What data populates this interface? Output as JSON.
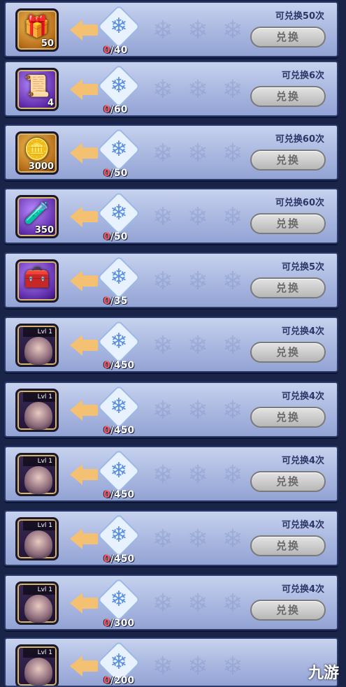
{
  "button_label": "兑换",
  "currency_icon": "snowflake-star-emblem",
  "colors": {
    "row_bg": "#a9b7e0",
    "arrow": "#f4c071",
    "current_count": "#ff5b5b",
    "button_disabled": "#b7b7b7"
  },
  "rows": [
    {
      "icon": "golden-chest-item-icon",
      "style": "gold",
      "glyph": "🎁",
      "qty": "50",
      "current": "0",
      "cost": "/40",
      "limit": "可兑换50次"
    },
    {
      "icon": "purple-scroll-icon",
      "style": "purple",
      "glyph": "📜",
      "qty": "4",
      "current": "0",
      "cost": "/60",
      "limit": "可兑换6次"
    },
    {
      "icon": "gold-coin-pile-icon",
      "style": "gold",
      "glyph": "🪙",
      "qty": "3000",
      "current": "0",
      "cost": "/50",
      "limit": "可兑换60次"
    },
    {
      "icon": "potion-bottle-icon",
      "style": "purple",
      "glyph": "🧪",
      "qty": "350",
      "current": "0",
      "cost": "/50",
      "limit": "可兑换60次"
    },
    {
      "icon": "treasure-chest-icon",
      "style": "purple",
      "glyph": "🧰",
      "qty": "",
      "current": "0",
      "cost": "/35",
      "limit": "可兑换5次"
    },
    {
      "icon": "hero-portrait-icon",
      "style": "hero",
      "level": "Lvl 1",
      "current": "0",
      "cost": "/450",
      "limit": "可兑换4次"
    },
    {
      "icon": "hero-portrait-icon",
      "style": "hero",
      "level": "Lvl 1",
      "current": "0",
      "cost": "/450",
      "limit": "可兑换4次"
    },
    {
      "icon": "hero-portrait-icon",
      "style": "hero",
      "level": "Lvl 1",
      "current": "0",
      "cost": "/450",
      "limit": "可兑换4次"
    },
    {
      "icon": "hero-portrait-icon",
      "style": "hero",
      "level": "Lvl 1",
      "current": "0",
      "cost": "/450",
      "limit": "可兑换4次"
    },
    {
      "icon": "hero-portrait-icon",
      "style": "hero",
      "level": "Lvl 1",
      "current": "0",
      "cost": "/300",
      "limit": "可兑换4次"
    },
    {
      "icon": "hero-portrait-icon",
      "style": "hero",
      "level": "Lvl 1",
      "current": "0",
      "cost": "/200",
      "limit": ""
    }
  ],
  "watermark": "九游"
}
